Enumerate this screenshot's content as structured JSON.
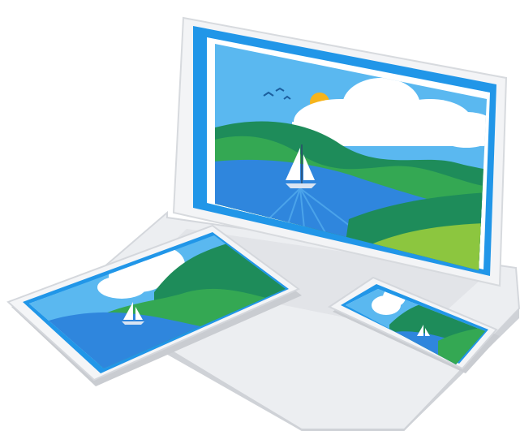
{
  "illustration": {
    "subject": "devices-showing-landscape",
    "devices": [
      {
        "kind": "laptop",
        "icon": "laptop-icon"
      },
      {
        "kind": "tablet",
        "icon": "tablet-icon"
      },
      {
        "kind": "phone",
        "icon": "phone-icon"
      }
    ],
    "scene": [
      "sky",
      "clouds",
      "sun",
      "birds",
      "hills",
      "lake",
      "sailboat"
    ]
  },
  "colors": {
    "device_frame": "#e9ebee",
    "device_shadow": "#c9ccd1",
    "screen_border": "#2196e8",
    "sky": "#5ab8f0",
    "cloud": "#ffffff",
    "sun": "#f6b41c",
    "hill_dark": "#1e8c5a",
    "hill_mid": "#34a853",
    "hill_light": "#8cc63f",
    "water": "#2f86dd",
    "water_light": "#4aa3ea",
    "sail": "#ffffff"
  }
}
